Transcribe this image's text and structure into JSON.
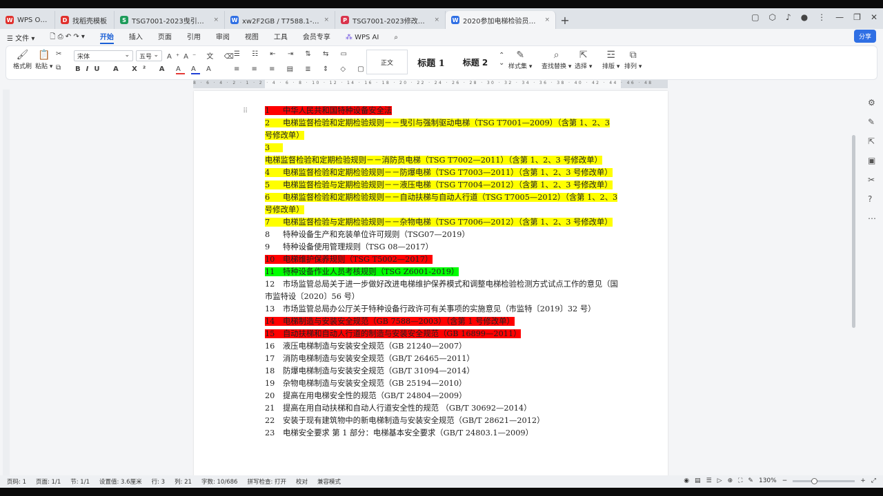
{
  "tabs": [
    {
      "label": "WPS Office",
      "icon": "wps-logo-icon",
      "color": "#e0302c",
      "glyph": "W"
    },
    {
      "label": "找稻壳模板",
      "icon": "docer-icon",
      "color": "#e0302c",
      "glyph": "D"
    },
    {
      "label": "TSG7001-2023曳引驱动乘客与载...",
      "icon": "sheet-icon",
      "color": "#1d9b5a",
      "glyph": "S"
    },
    {
      "label": "xw2F2GB / T7588.1-2020 电梯制造...",
      "icon": "word-icon",
      "color": "#2f6fe4",
      "glyph": "W"
    },
    {
      "label": "TSG7001-2023修改后(OCR).pdf",
      "icon": "pdf-icon",
      "color": "#d9344c",
      "glyph": "P"
    },
    {
      "label": "2020参加电梯检验员涉及标准...",
      "icon": "word-icon",
      "color": "#2f6fe4",
      "glyph": "W"
    }
  ],
  "menu": {
    "file": "文件",
    "items": [
      "开始",
      "插入",
      "页面",
      "引用",
      "审阅",
      "视图",
      "工具",
      "会员专享"
    ],
    "active": "开始",
    "wps_ai": "WPS AI",
    "share": "分享"
  },
  "ribbon": {
    "format_painter": "格式刷",
    "paste": "粘贴",
    "font_name": "宋体",
    "font_size": "五号",
    "style_normal": "正文",
    "style_h1": "标题 1",
    "style_h2": "标题 2",
    "style_set": "样式集",
    "find_replace": "查找替换",
    "select": "选择",
    "layout": "排版",
    "arrange": "排列"
  },
  "ruler_text": "8 · 6 · 4 · 2 · 1 · 2 · 4 · 6 · 8 · 10 · 12 · 14 · 16 · 18 · 20 · 22 · 24 · 26 · 28 · 30 · 32 · 34 · 36 · 38 · 40 · 42 · 44 · 46 · 48",
  "document": {
    "items": [
      {
        "n": "1",
        "text": "中华人民共和国特种设备安全法",
        "hl": "red"
      },
      {
        "n": "2",
        "text": "电梯监督检验和定期检验规则－－曳引与强制驱动电梯（TSG T7001—2009）（含第 1、2、3 号修改单）",
        "hl": "yellow"
      },
      {
        "n": "3",
        "text": "电梯监督检验和定期检验规则－－消防员电梯（TSG T7002—2011）（含第 1、2、3 号修改单）",
        "hl": "yellow"
      },
      {
        "n": "4",
        "text": "电梯监督检验和定期检验规则－－防爆电梯（TSG T7003—2011）（含第 1、2、3 号修改单）",
        "hl": "yellow"
      },
      {
        "n": "5",
        "text": "电梯监督检验与定期检验规则－－液压电梯（TSG T7004—2012）（含第 1、2、3 号修改单）",
        "hl": "yellow"
      },
      {
        "n": "6",
        "text": "电梯监督检验和定期检验规则－－自动扶梯与自动人行道（TSG T7005—2012）（含第 1、2、3 号修改单）",
        "hl": "yellow"
      },
      {
        "n": "7",
        "text": "电梯监督检验与定期检验规则－－杂物电梯（TSG T7006—2012）（含第 1、2、3 号修改单）",
        "hl": "yellow"
      },
      {
        "n": "8",
        "text": "特种设备生产和充装单位许可规则（TSG07—2019）",
        "hl": "none"
      },
      {
        "n": "9",
        "text": "特种设备使用管理规则（TSG 08—2017）",
        "hl": "none"
      },
      {
        "n": "10",
        "text": "电梯维护保养规则（TSG T5002—2017）",
        "hl": "red"
      },
      {
        "n": "11",
        "text": "特种设备作业人员考核规则（TSG Z6001-2019）",
        "hl": "green"
      },
      {
        "n": "12",
        "text": "市场监管总局关于进一步做好改进电梯维护保养模式和调整电梯检验检测方式试点工作的意见（国市监特设〔2020〕56 号）",
        "hl": "none"
      },
      {
        "n": "13",
        "text": "市场监管总局办公厅关于特种设备行政许可有关事项的实施意见（市监特〔2019〕32 号）",
        "hl": "none"
      },
      {
        "n": "14",
        "text": "电梯制造与安装安全规范（GB 7588—2003）（含第 1 号修改单）",
        "hl": "red"
      },
      {
        "n": "15",
        "text": "自动扶梯和自动人行道的制造与安装安全规范（GB 16899—2011）",
        "hl": "red"
      },
      {
        "n": "16",
        "text": "液压电梯制造与安装安全规范（GB 21240—2007）",
        "hl": "none"
      },
      {
        "n": "17",
        "text": "消防电梯制造与安装安全规范（GB/T 26465—2011）",
        "hl": "none"
      },
      {
        "n": "18",
        "text": "防爆电梯制造与安装安全规范（GB/T 31094—2014）",
        "hl": "none"
      },
      {
        "n": "19",
        "text": "杂物电梯制造与安装安全规范（GB 25194—2010）",
        "hl": "none"
      },
      {
        "n": "20",
        "text": "提高在用电梯安全性的规范（GB/T 24804—2009）",
        "hl": "none"
      },
      {
        "n": "21",
        "text": "提高在用自动扶梯和自动人行道安全性的规范 （GB/T 30692—2014）",
        "hl": "none"
      },
      {
        "n": "22",
        "text": "安装于现有建筑物中的新电梯制造与安装安全规范（GB/T 28621—2012）",
        "hl": "none"
      },
      {
        "n": "23",
        "text": "电梯安全要求 第 1 部分：电梯基本安全要求（GB/T 24803.1—2009）",
        "hl": "none"
      }
    ]
  },
  "status": {
    "page_num": "页码: 1",
    "pages": "页面: 1/1",
    "section": "节: 1/1",
    "setting": "设置值: 3.6厘米",
    "row": "行: 3",
    "col": "列: 21",
    "words": "字数: 10/686",
    "spell": "拼写检查: 打开",
    "proof": "校对",
    "compat": "兼容模式",
    "zoom": "130%",
    "zoom_level": 0.3
  },
  "colors": {
    "accent": "#1a5fd6",
    "yellow": "#ffff00",
    "red": "#ff0000",
    "green": "#00ff00"
  }
}
